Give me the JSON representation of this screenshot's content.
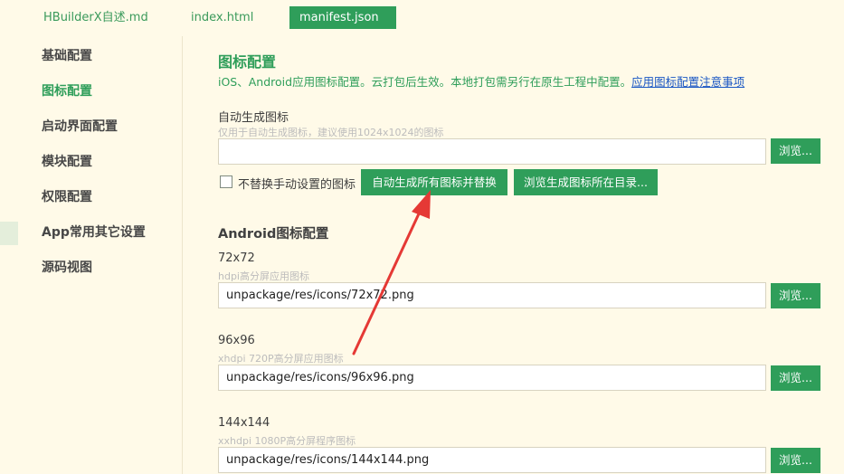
{
  "tabs": [
    {
      "label": "HBuilderX自述.md"
    },
    {
      "label": "index.html"
    },
    {
      "label": "manifest.json"
    }
  ],
  "sidebar": {
    "items": [
      {
        "label": "基础配置"
      },
      {
        "label": "图标配置"
      },
      {
        "label": "启动界面配置"
      },
      {
        "label": "模块配置"
      },
      {
        "label": "权限配置"
      },
      {
        "label": "App常用其它设置"
      },
      {
        "label": "源码视图"
      }
    ],
    "active_index": 1
  },
  "main": {
    "title": "图标配置",
    "description": "iOS、Android应用图标配置。云打包后生效。本地打包需另行在原生工程中配置。",
    "description_link": "应用图标配置注意事项",
    "auto": {
      "label": "自动生成图标",
      "hint": "仅用于自动生成图标，建议使用1024x1024的图标",
      "value": "",
      "browse_label": "浏览...",
      "checkbox_label": "不替换手动设置的图标",
      "checkbox_checked": false,
      "generate_button": "自动生成所有图标并替换",
      "browse_dir_button": "浏览生成图标所在目录..."
    },
    "android": {
      "title": "Android图标配置",
      "icons": [
        {
          "size": "72x72",
          "hint": "hdpi高分屏应用图标",
          "value": "unpackage/res/icons/72x72.png",
          "browse_label": "浏览..."
        },
        {
          "size": "96x96",
          "hint": "xhdpi 720P高分屏应用图标",
          "value": "unpackage/res/icons/96x96.png",
          "browse_label": "浏览..."
        },
        {
          "size": "144x144",
          "hint": "xxhdpi 1080P高分屏程序图标",
          "value": "unpackage/res/icons/144x144.png",
          "browse_label": "浏览..."
        }
      ]
    }
  },
  "colors": {
    "accent": "#2f9e5a",
    "background": "#fffae8",
    "link": "#1a57c4",
    "annotation_arrow": "#e53935"
  }
}
